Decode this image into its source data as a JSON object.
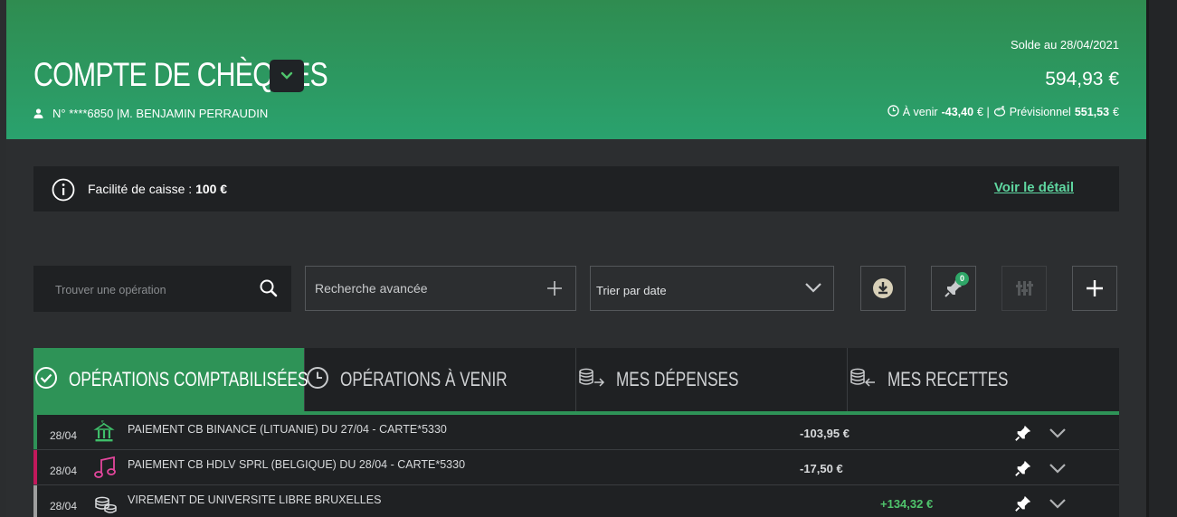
{
  "header": {
    "title": "COMPTE DE CHÈQUES",
    "account_number": "N° ****6850 |M. BENJAMIN PERRAUDIN",
    "solde_label": "Solde au 28/04/2021",
    "solde_amount": "594,93 €",
    "a_venir_label": "À venir",
    "a_venir_value": "-43,40",
    "euro1": "€ |",
    "previsionnel_label": "Prévisionnel",
    "previsionnel_value": "551,53",
    "euro2": "€"
  },
  "facilite": {
    "label": "Facilité de caisse :",
    "value": "100 €",
    "link": "Voir le détail"
  },
  "toolbar": {
    "search_placeholder": "Trouver une opération",
    "advanced_label": "Recherche avancée",
    "sort_label": "Trier par date",
    "pin_badge": "0"
  },
  "tabs": [
    {
      "label": "OPÉRATIONS COMPTABILISÉES",
      "icon": "check-circle-icon",
      "active": true
    },
    {
      "label": "OPÉRATIONS À VENIR",
      "icon": "clock-icon",
      "active": false
    },
    {
      "label": "MES DÉPENSES",
      "icon": "coins-out-icon",
      "active": false
    },
    {
      "label": "MES RECETTES",
      "icon": "coins-in-icon",
      "active": false
    }
  ],
  "operations": [
    {
      "date": "28/04",
      "label": "PAIEMENT CB BINANCE (LITUANIE) DU 27/04 - CARTE*5330",
      "amount": "-103,95 €",
      "category_icon": "bank-icon",
      "edge_color": "#2e9357"
    },
    {
      "date": "28/04",
      "label": "PAIEMENT CB HDLV SPRL (BELGIQUE) DU 28/04 - CARTE*5330",
      "amount": "-17,50 €",
      "category_icon": "music-note-icon",
      "edge_color": "#c2185b"
    },
    {
      "date": "28/04",
      "label": "VIREMENT DE UNIVERSITE LIBRE BRUXELLES",
      "amount": "+134,32 €",
      "category_icon": "coins-icon",
      "edge_color": "#9e9e9e"
    }
  ],
  "colors": {
    "brand_green": "#2e9357",
    "positive_amount": "#4fc46c",
    "link": "#5fd6a0"
  }
}
